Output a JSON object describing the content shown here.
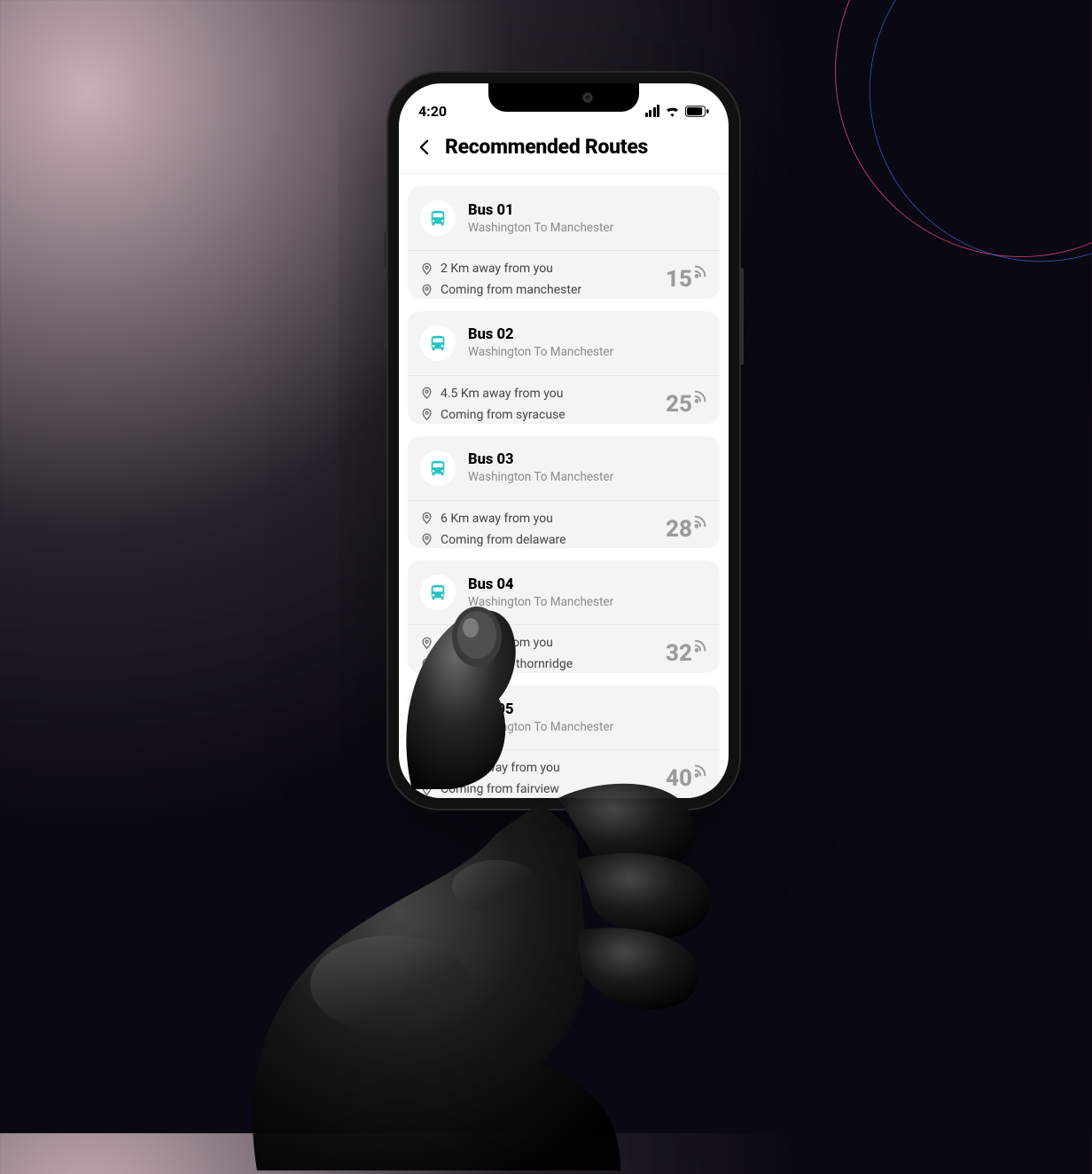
{
  "status": {
    "time": "4:20"
  },
  "header": {
    "title": "Recommended Routes"
  },
  "routes": [
    {
      "name": "Bus 01",
      "route": "Washington To Manchester",
      "distance": "2 Km away from you",
      "origin": "Coming from manchester",
      "count": "15"
    },
    {
      "name": "Bus 02",
      "route": "Washington To Manchester",
      "distance": "4.5 Km away from you",
      "origin": "Coming from syracuse",
      "count": "25"
    },
    {
      "name": "Bus 03",
      "route": "Washington To Manchester",
      "distance": "6 Km away from you",
      "origin": "Coming from delaware",
      "count": "28"
    },
    {
      "name": "Bus 04",
      "route": "Washington To Manchester",
      "distance": "8 Km away from you",
      "origin": "Coming from thornridge",
      "count": "32"
    },
    {
      "name": "Bus 05",
      "route": "Washington To Manchester",
      "distance": "10 Km away from you",
      "origin": "Coming from fairview",
      "count": "40"
    }
  ]
}
